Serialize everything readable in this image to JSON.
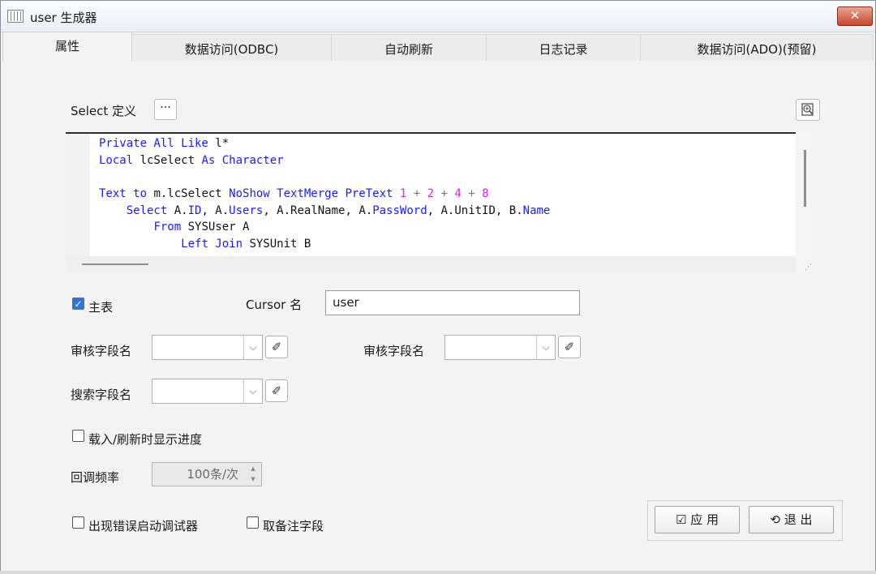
{
  "window": {
    "title": "user  生成器",
    "close_glyph": "✕"
  },
  "tabs": [
    "属性",
    "数据访问(ODBC)",
    "自动刷新",
    "日志记录",
    "数据访问(ADO)(预留)"
  ],
  "select_def": {
    "label": "Select 定义",
    "dots_label": "···"
  },
  "code": {
    "lines": [
      [
        [
          "kw",
          "Private All Like "
        ],
        [
          "tx",
          "l*"
        ]
      ],
      [
        [
          "kw",
          "Local "
        ],
        [
          "tx",
          "lcSelect "
        ],
        [
          "kw",
          "As Character"
        ]
      ],
      [],
      [
        [
          "kw",
          "Text to "
        ],
        [
          "tx",
          "m.lcSelect "
        ],
        [
          "kw",
          "NoShow TextMerge PreText "
        ],
        [
          "num",
          "1"
        ],
        [
          "op",
          " + "
        ],
        [
          "num",
          "2"
        ],
        [
          "op",
          " + "
        ],
        [
          "num",
          "4"
        ],
        [
          "op",
          " + "
        ],
        [
          "num",
          "8"
        ]
      ],
      [
        [
          "tx",
          "    "
        ],
        [
          "kw",
          "Select "
        ],
        [
          "tx",
          "A."
        ],
        [
          "kw",
          "ID"
        ],
        [
          "tx",
          ", A."
        ],
        [
          "kw",
          "Users"
        ],
        [
          "tx",
          ", A.RealName, A."
        ],
        [
          "kw",
          "PassWord"
        ],
        [
          "tx",
          ", A.UnitID, B."
        ],
        [
          "kw",
          "Name"
        ]
      ],
      [
        [
          "tx",
          "        "
        ],
        [
          "kw",
          "From "
        ],
        [
          "tx",
          "SYSUser A"
        ]
      ],
      [
        [
          "tx",
          "            "
        ],
        [
          "kw",
          "Left Join "
        ],
        [
          "tx",
          "SYSUnit B"
        ]
      ]
    ]
  },
  "main_table": {
    "label": "主表",
    "checked": true
  },
  "cursor": {
    "label": "Cursor 名",
    "value": "user"
  },
  "audit_field_1": {
    "label": "审核字段名",
    "value": ""
  },
  "audit_field_2": {
    "label": "审核字段名",
    "value": ""
  },
  "search_field": {
    "label": "搜索字段名",
    "value": ""
  },
  "show_progress": {
    "label": "载入/刷新时显示进度",
    "checked": false
  },
  "callback": {
    "label": "回调频率",
    "value": "100条/次"
  },
  "debugger": {
    "label": "出现错误启动调试器",
    "checked": false
  },
  "remark_field": {
    "label": "取备注字段",
    "checked": false
  },
  "buttons": {
    "apply": "应 用",
    "exit": "退 出"
  },
  "icons": {
    "app": "grid-window-icon",
    "close": "close-icon",
    "zoom": "zoom-in-icon",
    "brush": "broom-icon",
    "dropdown": "chevron-down-icon",
    "apply": "checklist-icon",
    "exit": "power-arrow-icon"
  }
}
